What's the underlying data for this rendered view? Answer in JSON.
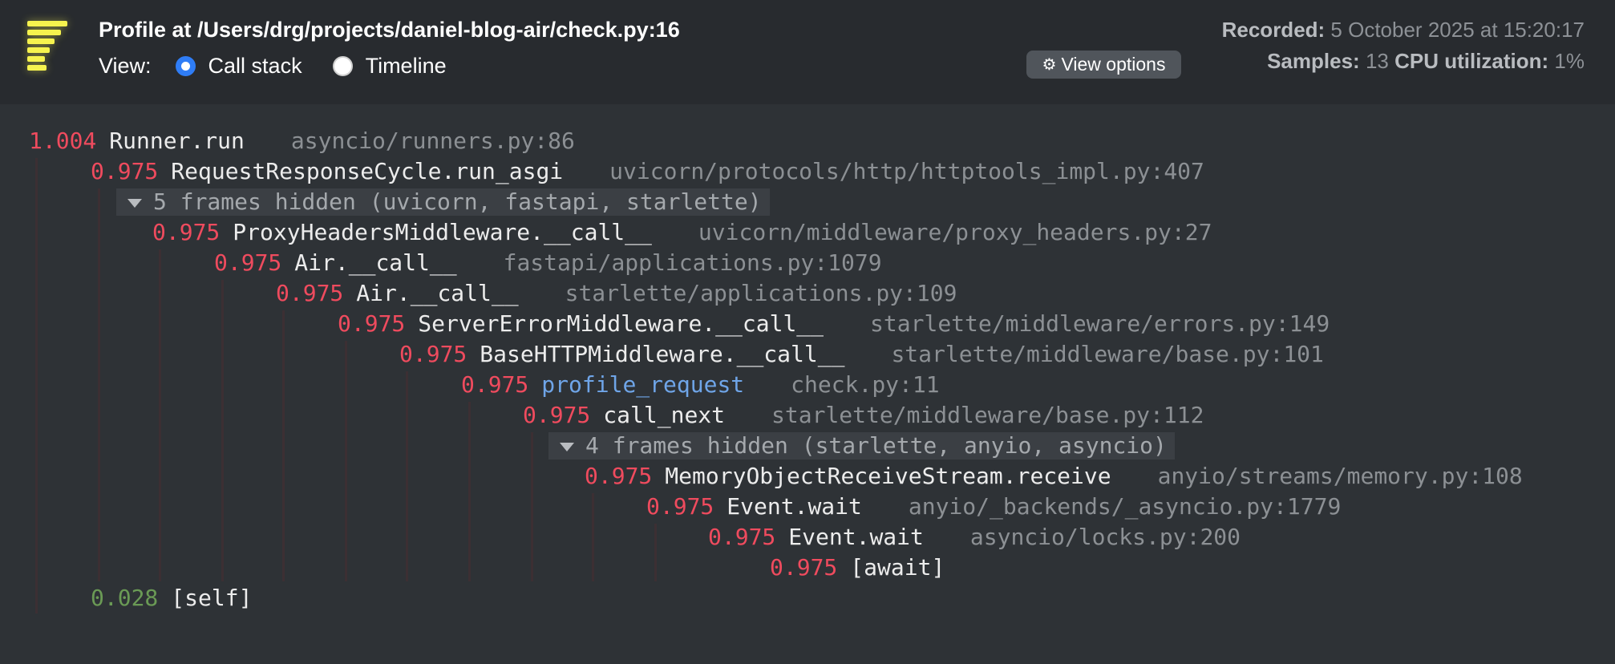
{
  "header": {
    "title": "Profile at /Users/drg/projects/daniel-blog-air/check.py:16",
    "view_label": "View:",
    "view_modes": [
      "Call stack",
      "Timeline"
    ],
    "selected_view": "Call stack",
    "view_options_label": "View options",
    "recorded_label": "Recorded:",
    "recorded_value": "5 October 2025 at 15:20:17",
    "samples_label": "Samples:",
    "samples_value": "13",
    "cpu_label": "CPU utilization:",
    "cpu_value": "1%"
  },
  "call_tree": {
    "frames": [
      {
        "time": "1.004",
        "function": "Runner.run",
        "location": "asyncio/runners.py:86"
      },
      {
        "time": "0.975",
        "function": "RequestResponseCycle.run_asgi",
        "location": "uvicorn/protocols/http/httptools_impl.py:407"
      },
      {
        "hidden": "5 frames hidden (uvicorn, fastapi, starlette)"
      },
      {
        "time": "0.975",
        "function": "ProxyHeadersMiddleware.__call__",
        "location": "uvicorn/middleware/proxy_headers.py:27"
      },
      {
        "time": "0.975",
        "function": "Air.__call__",
        "location": "fastapi/applications.py:1079"
      },
      {
        "time": "0.975",
        "function": "Air.__call__",
        "location": "starlette/applications.py:109"
      },
      {
        "time": "0.975",
        "function": "ServerErrorMiddleware.__call__",
        "location": "starlette/middleware/errors.py:149"
      },
      {
        "time": "0.975",
        "function": "BaseHTTPMiddleware.__call__",
        "location": "starlette/middleware/base.py:101"
      },
      {
        "time": "0.975",
        "function": "profile_request",
        "location": "check.py:11"
      },
      {
        "time": "0.975",
        "function": "call_next",
        "location": "starlette/middleware/base.py:112"
      },
      {
        "hidden": "4 frames hidden (starlette, anyio, asyncio)"
      },
      {
        "time": "0.975",
        "function": "MemoryObjectReceiveStream.receive",
        "location": "anyio/streams/memory.py:108"
      },
      {
        "time": "0.975",
        "function": "Event.wait",
        "location": "anyio/_backends/_asyncio.py:1779"
      },
      {
        "time": "0.975",
        "function": "Event.wait",
        "location": "asyncio/locks.py:200"
      },
      {
        "time": "0.975",
        "function": "[await]",
        "location": ""
      },
      {
        "time": "0.028",
        "function": "[self]",
        "location": ""
      }
    ]
  },
  "colors": {
    "background": "#2e3236",
    "header_background": "#282b2f",
    "time_red": "#ef4b5e",
    "time_green": "#6a9a55",
    "app_frame_blue": "#6fa5e8",
    "radio_blue": "#2f7df6",
    "logo_yellow": "#f6f34f"
  },
  "icons": {
    "logo": "pyinstrument-logo-icon",
    "view_options": "gear-icon",
    "hidden_frames": "triangle-down-icon"
  }
}
